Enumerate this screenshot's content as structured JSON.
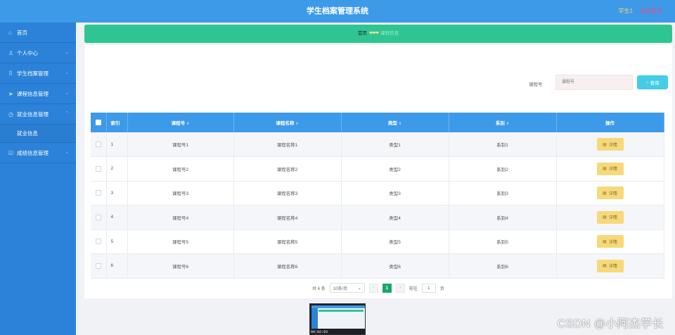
{
  "header": {
    "title": "学生档案管理系统",
    "user_role": "学生1",
    "logout": "退出登录"
  },
  "sidebar": {
    "items": [
      {
        "icon": "home-icon",
        "label": "首页"
      },
      {
        "icon": "user-icon",
        "label": "个人中心",
        "has_children": true
      },
      {
        "icon": "grid-icon",
        "label": "学生档案管理",
        "has_children": true
      },
      {
        "icon": "send-icon",
        "label": "课程信息管理",
        "has_children": true
      },
      {
        "icon": "clock-icon",
        "label": "就业信息管理",
        "has_children": true,
        "expanded": true,
        "children": [
          {
            "label": "就业信息"
          }
        ]
      },
      {
        "icon": "check-icon",
        "label": "成绩信息管理",
        "has_children": true
      }
    ]
  },
  "breadcrumb": {
    "home": "首页",
    "separator": "❤❤❤",
    "current": "课程信息"
  },
  "search": {
    "label": "课程号",
    "placeholder": "课程号",
    "button_label": "查询"
  },
  "table": {
    "columns": [
      "索引",
      "课程号",
      "课程名称",
      "类型",
      "系别",
      "操作"
    ],
    "rows": [
      {
        "index": "1",
        "course_no": "课程号1",
        "course_name": "课程名称1",
        "type": "类型1",
        "dept": "系别1",
        "action": "详情"
      },
      {
        "index": "2",
        "course_no": "课程号2",
        "course_name": "课程名称2",
        "type": "类型2",
        "dept": "系别2",
        "action": "详情"
      },
      {
        "index": "3",
        "course_no": "课程号3",
        "course_name": "课程名称3",
        "type": "类型3",
        "dept": "系别3",
        "action": "详情"
      },
      {
        "index": "4",
        "course_no": "课程号4",
        "course_name": "课程名称4",
        "type": "类型4",
        "dept": "系别4",
        "action": "详情"
      },
      {
        "index": "5",
        "course_no": "课程号5",
        "course_name": "课程名称5",
        "type": "类型5",
        "dept": "系别5",
        "action": "详情"
      },
      {
        "index": "6",
        "course_no": "课程号6",
        "course_name": "课程名称6",
        "type": "类型6",
        "dept": "系别6",
        "action": "详情"
      }
    ]
  },
  "pagination": {
    "total_text": "共 6 条",
    "page_size": "10条/页",
    "current_page": "1",
    "goto_label": "前往",
    "goto_value": "1",
    "page_unit": "页"
  },
  "video": {
    "timestamp": "00:02:03"
  },
  "watermark": "CSDN @小阿杰学长",
  "colors": {
    "header_bg": "#3d9ae9",
    "sidebar_bg": "#2b82d8",
    "breadcrumb_bg": "#2fc593",
    "search_button": "#45cde7",
    "detail_button": "#f6d97a",
    "active_page": "#1aa86a"
  }
}
